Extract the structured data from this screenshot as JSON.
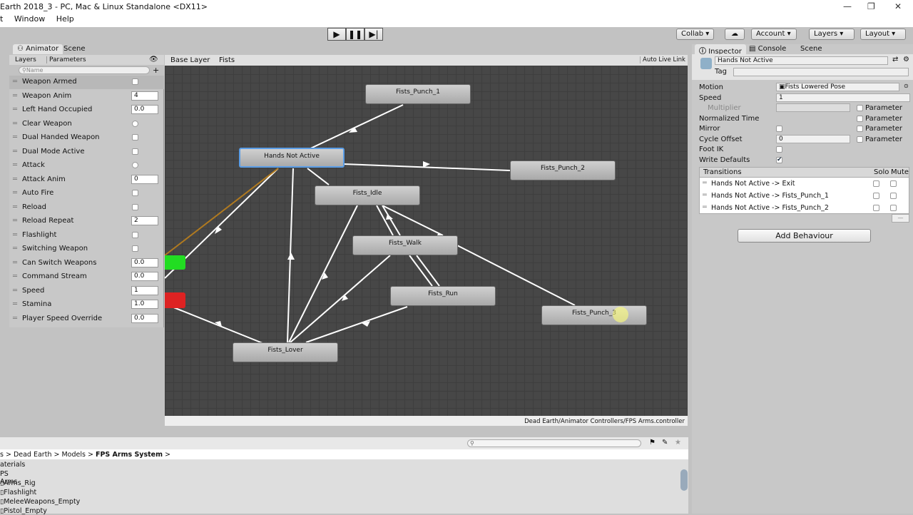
{
  "window": {
    "title": "Earth 2018_3 - PC, Mac & Linux Standalone <DX11>",
    "menu": [
      "t",
      "Window",
      "Help"
    ],
    "controls": [
      "minimize-icon",
      "restore-icon",
      "close-icon"
    ]
  },
  "toolbar": {
    "collab": "Collab ▾",
    "account": "Account",
    "layers": "Layers",
    "layout": "Layout"
  },
  "animator": {
    "tabs": [
      "Animator",
      "Scene"
    ],
    "subtabs": [
      "Layers",
      "Parameters"
    ],
    "search_placeholder": "Name",
    "breadcrumb": [
      "Base Layer",
      "Fists"
    ],
    "auto_live_link": "Auto Live Link",
    "path": "Dead Earth/Animator Controllers/FPS Arms.controller",
    "parameters": [
      {
        "name": "Weapon Armed",
        "type": "bool",
        "value": false
      },
      {
        "name": "Weapon Anim",
        "type": "int",
        "value": "4"
      },
      {
        "name": "Left Hand Occupied",
        "type": "float",
        "value": "0.0"
      },
      {
        "name": "Clear Weapon",
        "type": "trigger"
      },
      {
        "name": "Dual Handed Weapon",
        "type": "bool",
        "value": false
      },
      {
        "name": "Dual Mode Active",
        "type": "bool",
        "value": false
      },
      {
        "name": "Attack",
        "type": "trigger"
      },
      {
        "name": "Attack Anim",
        "type": "int",
        "value": "0"
      },
      {
        "name": "Auto Fire",
        "type": "bool",
        "value": false
      },
      {
        "name": "Reload",
        "type": "bool",
        "value": false
      },
      {
        "name": "Reload Repeat",
        "type": "int",
        "value": "2"
      },
      {
        "name": "Flashlight",
        "type": "bool",
        "value": false
      },
      {
        "name": "Switching Weapon",
        "type": "bool",
        "value": false
      },
      {
        "name": "Can Switch Weapons",
        "type": "float",
        "value": "0.0"
      },
      {
        "name": "Command Stream",
        "type": "float",
        "value": "0.0"
      },
      {
        "name": "Speed",
        "type": "int",
        "value": "1"
      },
      {
        "name": "Stamina",
        "type": "float",
        "value": "1.0"
      },
      {
        "name": "Player Speed Override",
        "type": "float",
        "value": "0.0"
      }
    ],
    "states": [
      "Fists_Punch_1",
      "Hands Not Active",
      "Fists_Punch_2",
      "Fists_Idle",
      "Fists_Walk",
      "Fists_Run",
      "Fists_Punch_3",
      "Fists_Lover"
    ],
    "colors": {
      "entry": "#22dd22",
      "exit": "#dd2222",
      "selected": "#5a9de6"
    }
  },
  "inspector": {
    "tabs": [
      "Inspector",
      "Console",
      "Scene"
    ],
    "name": "Hands Not Active",
    "tag_label": "Tag",
    "motion_label": "Motion",
    "motion": "Fists Lowered Pose",
    "speed_label": "Speed",
    "speed": "1",
    "multiplier_label": "Multiplier",
    "parameter_label": "Parameter",
    "normalized_time_label": "Normalized Time",
    "mirror_label": "Mirror",
    "cycle_offset_label": "Cycle Offset",
    "cycle_offset": "0",
    "foot_ik_label": "Foot IK",
    "write_defaults_label": "Write Defaults",
    "write_defaults": true,
    "transitions_label": "Transitions",
    "solo_label": "Solo",
    "mute_label": "Mute",
    "transitions": [
      "Hands Not Active -> Exit",
      "Hands Not Active -> Fists_Punch_1",
      "Hands Not Active -> Fists_Punch_2"
    ],
    "minus": "—",
    "add_behaviour": "Add Behaviour"
  },
  "project": {
    "breadcrumb": [
      "s",
      "Dead Earth",
      "Models",
      "FPS Arms System"
    ],
    "items": [
      "aterials",
      "PS Arms",
      "Arms_Rig",
      "Flashlight",
      "MeleeWeapons_Empty",
      "Pistol_Empty"
    ]
  }
}
